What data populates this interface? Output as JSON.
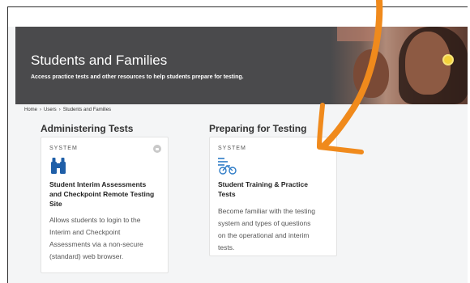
{
  "hero": {
    "title": "Students and Families",
    "subtitle": "Access practice tests and other resources to help students prepare for testing."
  },
  "breadcrumb": [
    "Home",
    "Users",
    "Students and Families"
  ],
  "breadcrumb_separator": "›",
  "sections": [
    {
      "title": "Administering Tests",
      "card": {
        "kind": "SYSTEM",
        "icon": "binoculars-icon",
        "title_lines": [
          "Student Interim Assessments",
          "and Checkpoint Remote Testing",
          "Site"
        ],
        "desc_lines": [
          "Allows students to login to the",
          "Interim and Checkpoint",
          "Assessments via a non-secure",
          "(standard) web browser."
        ],
        "badge_icon": "lock-icon"
      }
    },
    {
      "title": "Preparing for Testing",
      "card": {
        "kind": "SYSTEM",
        "icon": "training-bike-icon",
        "title_lines": [
          "Student Training & Practice",
          "Tests"
        ],
        "desc_lines": [
          "Become familiar with the testing",
          "system and types of questions",
          "on the operational and interim",
          "tests."
        ]
      }
    }
  ],
  "colors": {
    "hero_bg": "#4a4a4c",
    "icon_blue": "#1f5fa8",
    "annotation_arrow": "#f08a1c"
  }
}
